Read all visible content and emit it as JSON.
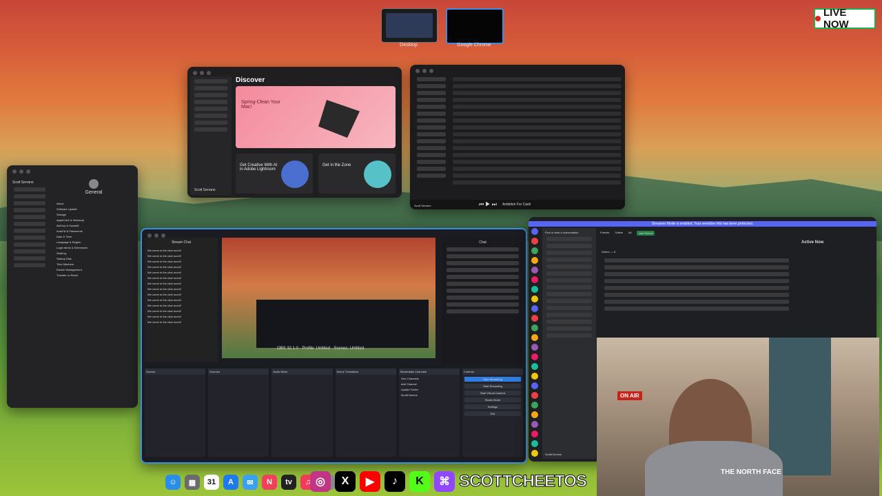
{
  "spaces": {
    "desktop_label": "Desktop",
    "chrome_label": "Google Chrome"
  },
  "live_badge": {
    "label": "LIVE NOW"
  },
  "settings_window": {
    "title": "General",
    "user_name": "Scott Serrano",
    "items": [
      "About",
      "Software Update",
      "Storage",
      "AppleCare & Warranty",
      "AirDrop & Handoff",
      "AutoFill & Passwords",
      "Date & Time",
      "Language & Region",
      "Login Items & Extensions",
      "Sharing",
      "Startup Disk",
      "Time Machine",
      "Device Management",
      "Transfer or Reset"
    ]
  },
  "appstore_window": {
    "heading": "Discover",
    "hero_text": "Spring-Clean Your Mac!",
    "card1_text": "Get Creative With AI in Adobe Lightroom",
    "card2_text": "Get in the Zone",
    "user_name": "Scott Serrano"
  },
  "music_window": {
    "now_playing": "Ambition For Cash",
    "user_name": "Scott Serrano"
  },
  "obs_window": {
    "chat_title": "Stream Chat",
    "chat_line": "We come to the chat room!!",
    "chat_panel_title": "Chat",
    "overlay_text": "OBS 32.1.0 - Profile: Untitled - Scenes: Untitled",
    "sections": [
      "Scenes",
      "Sources",
      "Audio Mixer",
      "Scene Transitions",
      "Streamlabs Channels",
      "Controls"
    ],
    "controls": [
      "Start Streaming",
      "Start Recording",
      "Start Virtual Camera",
      "Studio Mode",
      "Settings",
      "Exit"
    ],
    "channels_header": "Your Channels",
    "add_channel": "Add Channel",
    "update_folder": "Update Folder",
    "channel_name": "ScottCheetos"
  },
  "discord_window": {
    "banner": "Streamer Mode is enabled. Your sensitive info has been protected.",
    "tabs": [
      "Friends",
      "Online",
      "All",
      "Add Friend"
    ],
    "active_now": "Active Now",
    "search_placeholder": "Find or start a conversation",
    "online_count": "Online — 8",
    "user_name": "ScottCheetos"
  },
  "webcam": {
    "sign": "ON AIR",
    "hoodie": "THE NORTH FACE"
  },
  "dock_apps": [
    "finder",
    "launchpad",
    "calendar",
    "app-store",
    "mail",
    "news",
    "tv",
    "music",
    "system-settings"
  ],
  "social": {
    "handle": "SCOTTCHEETOS",
    "icons": [
      "instagram-icon",
      "x-icon",
      "youtube-icon",
      "tiktok-icon",
      "kick-icon",
      "twitch-icon"
    ]
  },
  "colors": {
    "live_border": "#1db34a",
    "discord_banner": "#5865f2",
    "obs_accent": "#2f7de0"
  }
}
